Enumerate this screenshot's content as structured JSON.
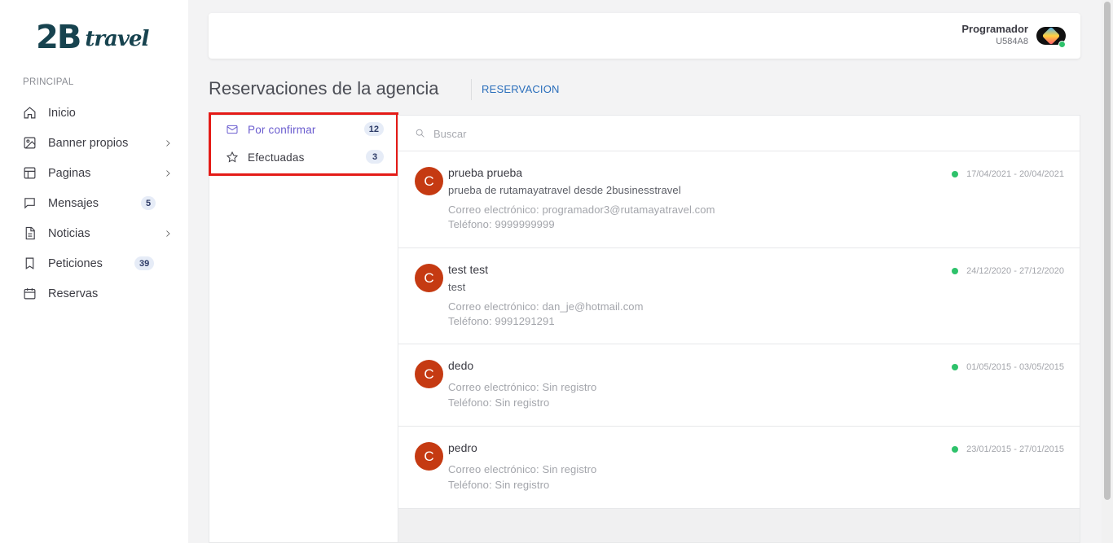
{
  "brand": {
    "logo_main": "2B",
    "logo_script": "travel"
  },
  "sidebar": {
    "section_label": "PRINCIPAL",
    "items": [
      {
        "label": "Inicio",
        "icon": "home-icon",
        "has_submenu": false,
        "badge": null
      },
      {
        "label": "Banner propios",
        "icon": "image-icon",
        "has_submenu": true,
        "badge": null
      },
      {
        "label": "Paginas",
        "icon": "layout-icon",
        "has_submenu": true,
        "badge": null
      },
      {
        "label": "Mensajes",
        "icon": "message-icon",
        "has_submenu": false,
        "badge": "5"
      },
      {
        "label": "Noticias",
        "icon": "file-text-icon",
        "has_submenu": true,
        "badge": null
      },
      {
        "label": "Peticiones",
        "icon": "bookmark-icon",
        "has_submenu": false,
        "badge": "39"
      },
      {
        "label": "Reservas",
        "icon": "calendar-icon",
        "has_submenu": false,
        "badge": null
      }
    ]
  },
  "header": {
    "user_name": "Programador",
    "user_code": "U584A8",
    "online_color": "#2ec26b"
  },
  "page": {
    "title": "Reservaciones de la agencia",
    "crumb": "RESERVACION"
  },
  "filters": [
    {
      "label": "Por confirmar",
      "count": "12",
      "active": true,
      "icon": "mail-icon"
    },
    {
      "label": "Efectuadas",
      "count": "3",
      "active": false,
      "icon": "star-icon"
    }
  ],
  "search": {
    "placeholder": "Buscar"
  },
  "reservations": [
    {
      "initial": "C",
      "name": "prueba prueba",
      "description": "prueba de rutamayatravel desde 2businesstravel",
      "email": "Correo electrónico: programador3@rutamayatravel.com",
      "phone": "Teléfono: 9999999999",
      "dates": "17/04/2021 - 20/04/2021"
    },
    {
      "initial": "C",
      "name": "test test",
      "description": "test",
      "email": "Correo electrónico: dan_je@hotmail.com",
      "phone": "Teléfono: 9991291291",
      "dates": "24/12/2020 - 27/12/2020"
    },
    {
      "initial": "C",
      "name": "dedo",
      "description": "",
      "email": "Correo electrónico: Sin registro",
      "phone": "Teléfono: Sin registro",
      "dates": "01/05/2015 - 03/05/2015"
    },
    {
      "initial": "C",
      "name": "pedro",
      "description": "",
      "email": "Correo electrónico: Sin registro",
      "phone": "Teléfono: Sin registro",
      "dates": "23/01/2015 - 27/01/2015"
    }
  ],
  "colors": {
    "accent": "#6a5ccf",
    "link": "#2a6ebb",
    "avatar_bg": "#c53a12",
    "status_dot": "#2ec26b",
    "highlight": "#e41b17"
  }
}
